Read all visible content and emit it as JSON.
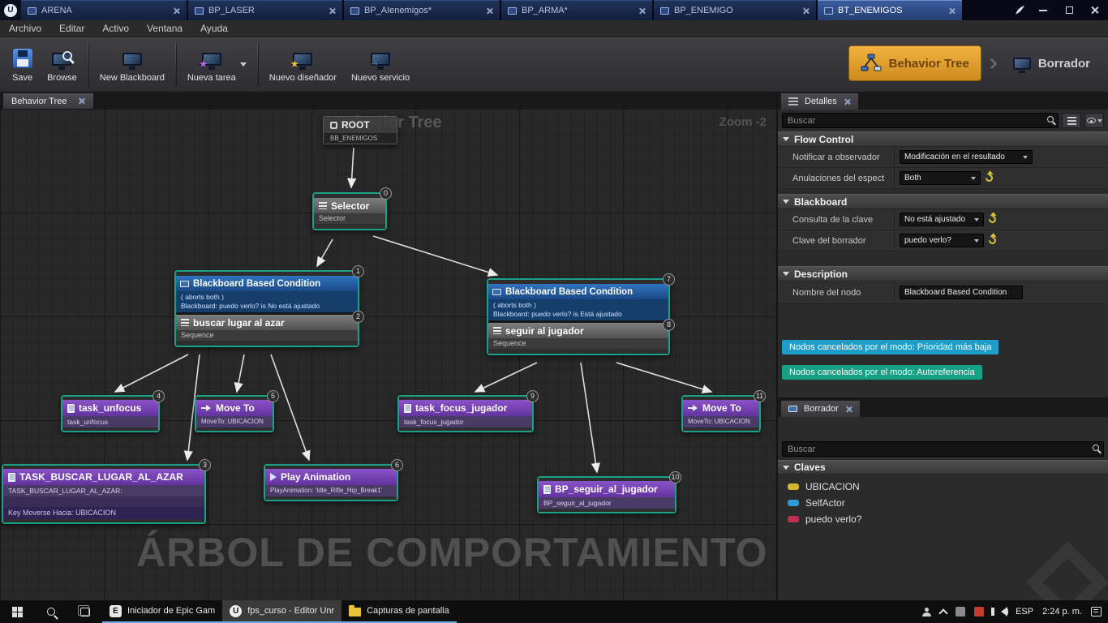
{
  "colors": {
    "accent_orange": "#e89c28",
    "selection_teal": "#1aa188",
    "task_purple": "#7a46b0",
    "decorator_blue": "#2f74c0",
    "notice_cyan": "#1e9dc8",
    "notice_green": "#16a085",
    "key_ubicacion": "#d4b62e",
    "key_selfactor": "#2e9ad8",
    "key_puedo_verlo": "#c02e50"
  },
  "icons": {
    "unreal": "U",
    "epic": "E"
  },
  "titlebar": {
    "tabs": [
      {
        "label": "ARENA"
      },
      {
        "label": "BP_LASER"
      },
      {
        "label": "BP_AIenemigos*"
      },
      {
        "label": "BP_ARMA*"
      },
      {
        "label": "BP_ENEMIGO"
      },
      {
        "label": "BT_ENEMIGOS"
      }
    ]
  },
  "menubar": {
    "items": [
      "Archivo",
      "Editar",
      "Activo",
      "Ventana",
      "Ayuda"
    ]
  },
  "toolbar": {
    "buttons": [
      "Save",
      "Browse",
      "New Blackboard",
      "Nueva tarea",
      "Nuevo diseñador",
      "Nuevo servicio"
    ],
    "mode_active": "Behavior Tree",
    "mode_inactive": "Borrador"
  },
  "graph": {
    "doc_tab": "Behavior Tree",
    "watermark_title": "Behavior Tree",
    "zoom_label": "Zoom -2",
    "watermark_bottom": "ÁRBOL DE COMPORTAMIENTO",
    "root": {
      "title": "ROOT",
      "subtitle": "BB_ENEMIGOS"
    },
    "selector": {
      "title": "Selector",
      "subtitle": "Selector",
      "badge": "0"
    },
    "conditions": [
      {
        "title": "Blackboard Based Condition",
        "aborts": "( aborts both )",
        "rule": "Blackboard: puedo verlo? is No está ajustado",
        "badge_top": "1",
        "badge_bottom": "2",
        "composite_title": "buscar lugar al azar",
        "composite_subtitle": "Sequence"
      },
      {
        "title": "Blackboard Based Condition",
        "aborts": "( aborts both )",
        "rule": "Blackboard: puedo verlo? is Está ajustado",
        "badge_top": "7",
        "badge_bottom": "8",
        "composite_title": "seguir al jugador",
        "composite_subtitle": "Sequence"
      }
    ],
    "tasks": [
      {
        "title": "task_unfocus",
        "subtitle": "task_unfocus",
        "badge": "4"
      },
      {
        "title": "Move To",
        "subtitle": "MoveTo: UBICACION",
        "badge": "5"
      },
      {
        "title": "task_focus_jugador",
        "subtitle": "task_focus_jugador",
        "badge": "9"
      },
      {
        "title": "Move To",
        "subtitle": "MoveTo: UBICACION",
        "badge": "11"
      },
      {
        "title": "TASK_BUSCAR_LUGAR_AL_AZAR",
        "subtitle": "TASK_BUSCAR_LUGAR_AL_AZAR:",
        "footer": "Key Moverse Hacia: UBICACION",
        "badge": "3"
      },
      {
        "title": "Play Animation",
        "subtitle": "PlayAnimation: 'Idle_Rifle_Hip_Break1'",
        "badge": "6"
      },
      {
        "title": "BP_seguir_al_jugador",
        "subtitle": "BP_seguir_al_jugador",
        "badge": "10"
      }
    ]
  },
  "details": {
    "tab": "Detalles",
    "search_placeholder": "Buscar",
    "sections": {
      "flow_control": "Flow Control",
      "blackboard": "Blackboard",
      "description": "Description"
    },
    "rows": [
      {
        "label": "Notificar a observador",
        "value": "Modificación en el resultado"
      },
      {
        "label": "Anulaciones del espect",
        "value": "Both"
      },
      {
        "label": "Consulta de la clave",
        "value": "No está ajustado"
      },
      {
        "label": "Clave del borrador",
        "value": "puedo verlo?"
      },
      {
        "label": "Nombre del nodo",
        "value": "Blackboard Based Condition"
      }
    ],
    "notices": [
      {
        "text": "Nodos cancelados por el modo: Prioridad más baja",
        "color": "#1e9dc8"
      },
      {
        "text": "Nodos cancelados por el modo: Autoreferencia",
        "color": "#16a085"
      }
    ]
  },
  "blackboard_panel": {
    "tab": "Borrador",
    "search_placeholder": "Buscar",
    "section": "Claves",
    "keys": [
      {
        "name": "UBICACION",
        "color": "#d4b62e"
      },
      {
        "name": "SelfActor",
        "color": "#2e9ad8"
      },
      {
        "name": "puedo verlo?",
        "color": "#c02e50"
      }
    ]
  },
  "taskbar": {
    "apps": [
      "Iniciador de Epic Gam",
      "fps_curso - Editor Unr",
      "Capturas de pantalla"
    ],
    "language": "ESP",
    "time": "2:24 p. m."
  }
}
